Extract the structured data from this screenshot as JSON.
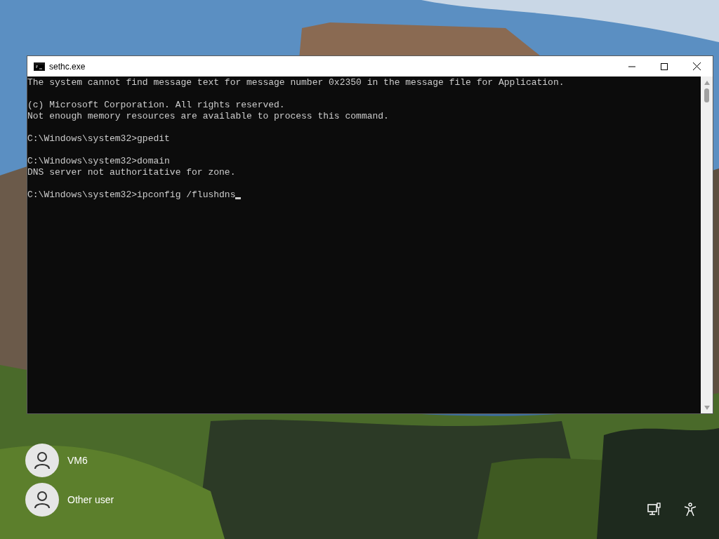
{
  "window": {
    "title": "sethc.exe"
  },
  "console": {
    "blocks": [
      [
        "The system cannot find message text for message number 0x2350 in the message file for Application."
      ],
      [
        "(c) Microsoft Corporation. All rights reserved.",
        "Not enough memory resources are available to process this command."
      ],
      [
        "C:\\Windows\\system32>gpedit"
      ],
      [
        "C:\\Windows\\system32>domain",
        "DNS server not authoritative for zone."
      ],
      [
        "C:\\Windows\\system32>ipconfig /flushdns"
      ]
    ]
  },
  "users": [
    {
      "name": "VM6"
    },
    {
      "name": "Other user"
    }
  ]
}
